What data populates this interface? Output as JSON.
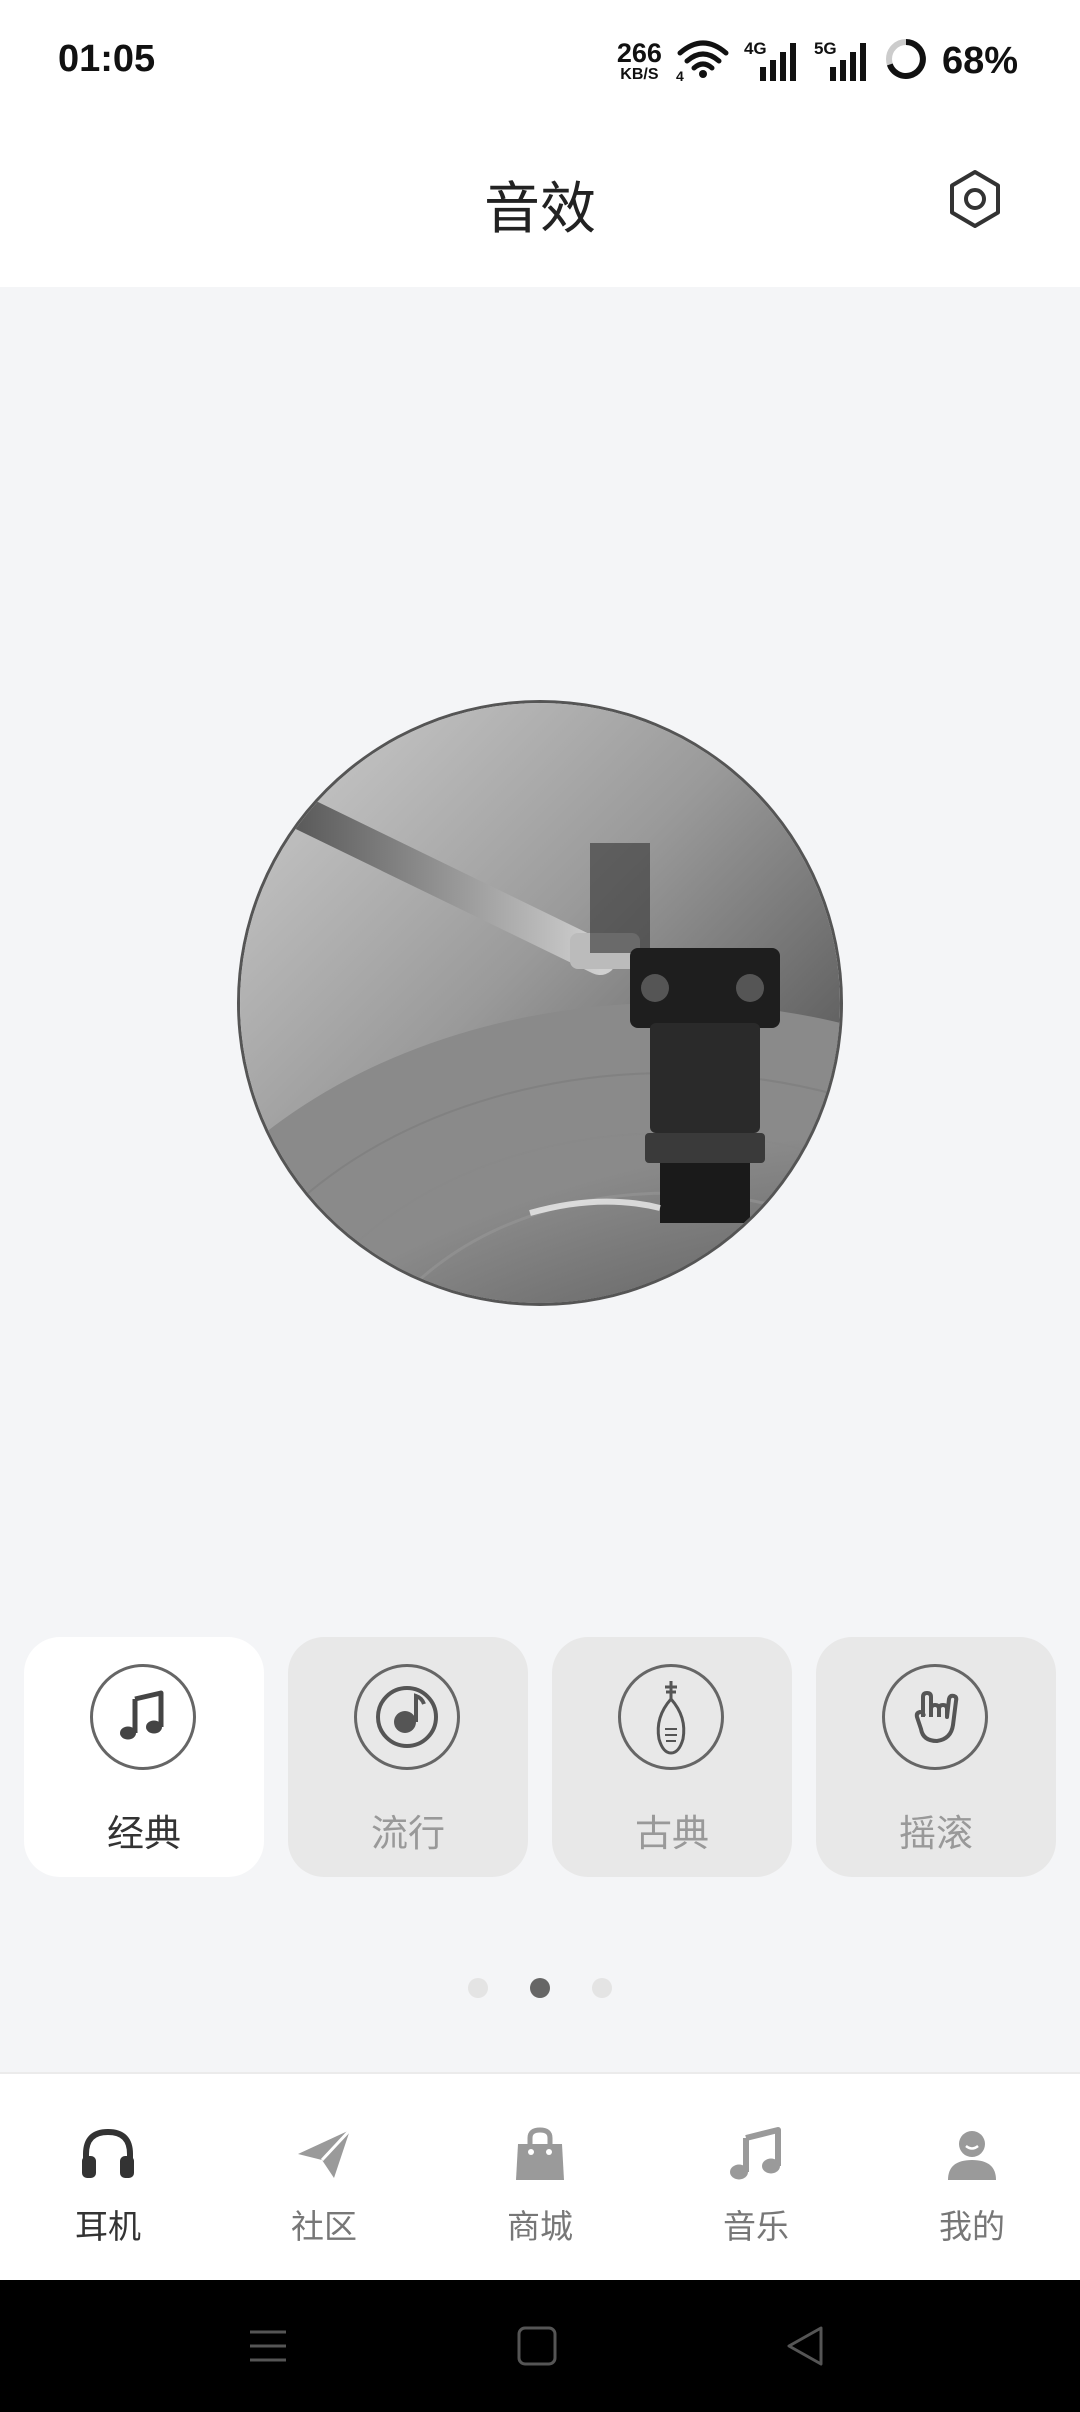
{
  "status_bar": {
    "time": "01:05",
    "net_speed_value": "266",
    "net_speed_unit": "KB/S",
    "signal_1_label": "4G",
    "signal_2_label": "5G",
    "battery": "68%"
  },
  "header": {
    "title": "音效",
    "settings_icon": "settings-hexagon-icon"
  },
  "artwork": {
    "icon": "vinyl-record-player-image"
  },
  "effects": [
    {
      "label": "经典",
      "icon": "music-note-icon",
      "selected": true
    },
    {
      "label": "流行",
      "icon": "disc-note-icon",
      "selected": false
    },
    {
      "label": "古典",
      "icon": "pipa-instrument-icon",
      "selected": false
    },
    {
      "label": "摇滚",
      "icon": "rock-hand-icon",
      "selected": false
    }
  ],
  "pager": {
    "count": 3,
    "active_index": 1
  },
  "bottom_nav": [
    {
      "label": "耳机",
      "icon": "headphones-icon",
      "active": true
    },
    {
      "label": "社区",
      "icon": "paper-plane-icon",
      "active": false
    },
    {
      "label": "商城",
      "icon": "shopping-bag-icon",
      "active": false
    },
    {
      "label": "音乐",
      "icon": "music-note-icon",
      "active": false
    },
    {
      "label": "我的",
      "icon": "user-icon",
      "active": false
    }
  ],
  "system_nav": {
    "menu_icon": "menu-lines-icon",
    "home_icon": "home-square-icon",
    "back_icon": "back-triangle-icon"
  },
  "colors": {
    "background": "#f4f5f7",
    "card_selected": "#ffffff",
    "card_unselected": "#e8e8e8",
    "active_text": "#333333",
    "inactive_text": "#999999"
  }
}
